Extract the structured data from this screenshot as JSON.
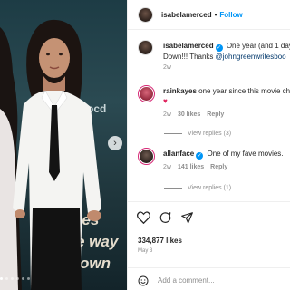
{
  "post": {
    "username": "isabelamerced",
    "follow_separator": "•",
    "follow_label": "Follow"
  },
  "caption": {
    "username": "isabelamerced",
    "text": "One year (and 1 day)",
    "text2": "Down!!! Thanks ",
    "mention": "@johngreenwritesboo",
    "timestamp": "2w"
  },
  "comments": [
    {
      "username": "rainkayes",
      "text": "one year since this movie ch",
      "emoji": "♥",
      "age": "2w",
      "likes": "30 likes",
      "reply": "Reply",
      "view_replies": "View replies (3)",
      "avatar_color": "#b0394a"
    },
    {
      "username": "allanface",
      "text": "One of my fave movies.",
      "age": "2w",
      "likes": "141 likes",
      "reply": "Reply",
      "view_replies": "View replies (1)",
      "avatar_color": "#3a2f2a"
    }
  ],
  "likes_count": "334,877 likes",
  "date": "May 3",
  "add_comment_placeholder": "Add a comment...",
  "media_caption_visible": "tles\ne way\nown",
  "media_side_text": "ocd",
  "icons": [
    "heart-icon",
    "comment-icon",
    "share-icon",
    "emoji-icon",
    "next-arrow-icon",
    "verified-badge-icon"
  ],
  "colors": {
    "accent": "#0095f6",
    "text": "#262626",
    "muted": "#8e8e8e"
  }
}
